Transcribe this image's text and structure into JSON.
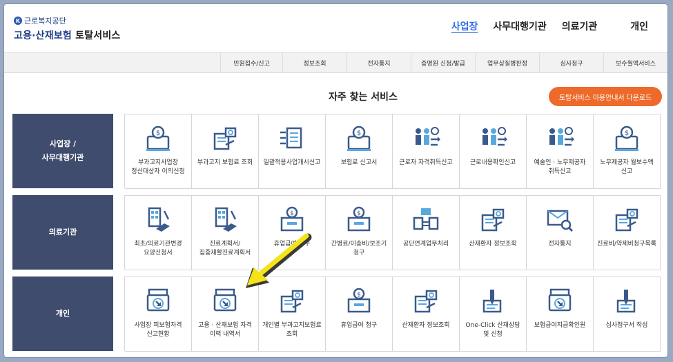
{
  "header": {
    "org_name": "근로복지공단",
    "logo_mark": "K",
    "service_title_blue": "고용·산재보험",
    "service_title_dark": "토탈서비스",
    "nav": [
      "사업장",
      "사무대행기관",
      "의료기관",
      "개인"
    ]
  },
  "subnav": [
    "민원접수/신고",
    "정보조회",
    "전자통지",
    "증명원 신청/발급",
    "업무상질병판정",
    "심사청구",
    "보수월액서비스"
  ],
  "section": {
    "title": "자주 찾는 서비스",
    "download_label": "토탈서비스 이용안내서 다운로드"
  },
  "rows": [
    {
      "label": "사업장 /\n사무대행기관",
      "cells": [
        {
          "label": "부과고지사업장 정산대상자 이의신청",
          "icon": "money-monitor-icon"
        },
        {
          "label": "부과고지 보험료 조회",
          "icon": "document-search-icon"
        },
        {
          "label": "일괄적용사업개시신고",
          "icon": "document-stack-icon"
        },
        {
          "label": "보험료 신고서",
          "icon": "money-monitor-icon"
        },
        {
          "label": "근로자 자격취득신고",
          "icon": "workers-transfer-icon"
        },
        {
          "label": "근로내용확인신고",
          "icon": "workers-transfer-icon"
        },
        {
          "label": "예술인 · 노무제공자 취득신고",
          "icon": "workers-transfer-icon"
        },
        {
          "label": "노무제공자 월보수액 신고",
          "icon": "money-monitor-icon"
        }
      ]
    },
    {
      "label": "의료기관",
      "cells": [
        {
          "label": "최초/의료기관변경 요양신청서",
          "icon": "building-hand-icon"
        },
        {
          "label": "진료계획서/집중재활진료계획서",
          "icon": "building-hand-icon"
        },
        {
          "label": "휴업급여 청구",
          "icon": "money-box-icon"
        },
        {
          "label": "간병료/이송비/보조기 청구",
          "icon": "money-box-icon"
        },
        {
          "label": "공단연계업무처리",
          "icon": "folder-exchange-icon"
        },
        {
          "label": "산재환자 정보조회",
          "icon": "document-search-icon"
        },
        {
          "label": "전자통지",
          "icon": "mailbox-search-icon"
        },
        {
          "label": "진료비/약제비청구목록",
          "icon": "document-search-icon"
        }
      ]
    },
    {
      "label": "개인",
      "cells": [
        {
          "label": "사업장 피보험자격 신고현황",
          "icon": "download-box-icon"
        },
        {
          "label": "고용 · 산재보험 자격 이력 내역서",
          "icon": "download-box-icon"
        },
        {
          "label": "개인별 부과고지보험료 조회",
          "icon": "document-search-icon"
        },
        {
          "label": "휴업급여 청구",
          "icon": "money-box-icon"
        },
        {
          "label": "산재환자 정보조회",
          "icon": "document-search-icon"
        },
        {
          "label": "One-Click 산재상담 및 신청",
          "icon": "pen-document-icon"
        },
        {
          "label": "보험급여지급확인원",
          "icon": "download-box-icon"
        },
        {
          "label": "심사청구서 작성",
          "icon": "pen-document-icon"
        }
      ]
    }
  ],
  "colors": {
    "row_label_bg": "#3f4c6e",
    "accent_blue": "#2d6be8",
    "download_orange": "#ee6a2a",
    "icon_navy": "#3a5a8c",
    "icon_blue": "#5aa7dd",
    "arrow_yellow": "#f5e31a"
  }
}
